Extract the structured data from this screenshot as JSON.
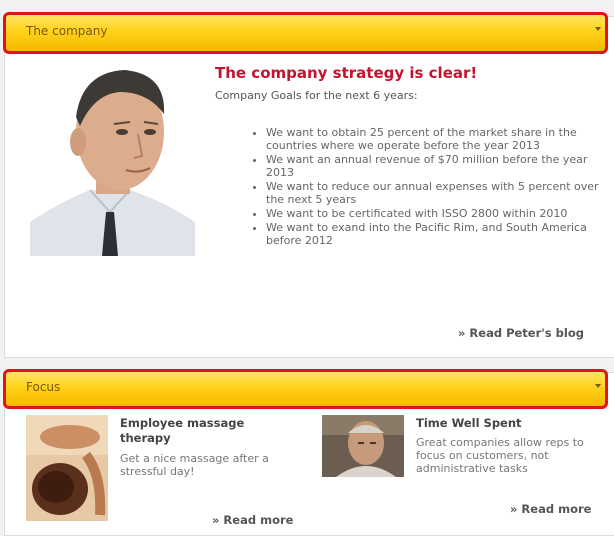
{
  "company_section": {
    "header": "The company",
    "headline": "The company strategy is clear!",
    "subline": "Company Goals for the next 6 years:",
    "goals": [
      "We want to obtain 25 percent of the market share in the countries where we operate before the year 2013",
      "We want an annual revenue of $70 million before the year 2013",
      "We want to reduce our annual expenses with 5 percent over the next 5 years",
      "We want to be certificated with ISSO 2800 within 2010",
      "We want to exand into the Pacific Rim, and South America before 2012"
    ],
    "read_more": "» Read Peter's blog"
  },
  "focus_section": {
    "header": "Focus",
    "cards": [
      {
        "title": "Employee massage therapy",
        "text": "Get a nice massage after a stressful day!",
        "read_more": "» Read more"
      },
      {
        "title": "Time Well Spent",
        "text": "Great companies allow reps to focus on customers, not administrative tasks",
        "read_more": "» Read more"
      }
    ]
  },
  "colors": {
    "header_gradient": [
      "#ffe566",
      "#f7b800"
    ],
    "highlight_outline": "#e3121b",
    "headline": "#c4122f"
  }
}
